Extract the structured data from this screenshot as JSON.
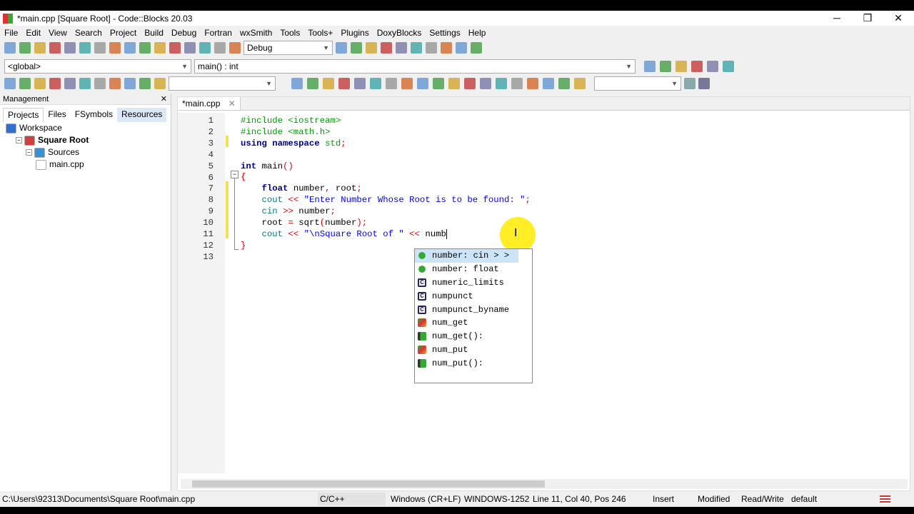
{
  "window": {
    "title": "*main.cpp [Square Root] - Code::Blocks 20.03",
    "minimize": "─",
    "restore": "❐",
    "close": "✕"
  },
  "menu": [
    "File",
    "Edit",
    "View",
    "Search",
    "Project",
    "Build",
    "Debug",
    "Fortran",
    "wxSmith",
    "Tools",
    "Tools+",
    "Plugins",
    "DoxyBlocks",
    "Settings",
    "Help"
  ],
  "toolbar1": {
    "icons": [
      "new-file",
      "open",
      "save",
      "save-all",
      "undo",
      "redo",
      "cut",
      "copy",
      "paste",
      "find",
      "replace",
      "build",
      "run",
      "build-run",
      "rebuild",
      "abort"
    ],
    "build_target": "Debug",
    "debug_icons": [
      "debug-run",
      "step-into",
      "step-over",
      "step-out",
      "next-instr",
      "step-instr",
      "break",
      "stop",
      "debug-windows",
      "info"
    ]
  },
  "toolbar2": {
    "scope": "<global>",
    "function": "main() : int",
    "icons": [
      "jump-back",
      "jump-forward",
      "toggle-bookmark",
      "prev-bookmark",
      "next-bookmark",
      "clear-bookmarks"
    ]
  },
  "toolbar3": {
    "search_value": "",
    "search2_value": "",
    "icons": [
      "doxy-extract",
      "doxy-run",
      "comment-block",
      "comment-line",
      "html",
      "chm",
      "settings",
      "prev-mark",
      "mark",
      "next-mark",
      "clear"
    ],
    "right_icons": [
      "prev",
      "next",
      "highlight",
      "insert",
      "match-case",
      "regex",
      "select",
      "rect",
      "fit",
      "box1",
      "box2",
      "box3",
      "box4",
      "box5",
      "box6",
      "zoom-in",
      "zoom-out",
      "s-icon",
      "c-icon"
    ]
  },
  "management": {
    "title": "Management",
    "tabs": [
      "Projects",
      "Files",
      "FSymbols",
      "Resources"
    ],
    "tree": [
      {
        "label": "Workspace",
        "level": 0
      },
      {
        "label": "Square Root",
        "level": 1,
        "bold": true
      },
      {
        "label": "Sources",
        "level": 2
      },
      {
        "label": "main.cpp",
        "level": 3
      }
    ]
  },
  "editor": {
    "tab": "*main.cpp",
    "tab_close": "✕",
    "lines": [
      [
        [
          "#include <iostream>",
          "pp"
        ]
      ],
      [
        [
          "#include <math.h>",
          "pp"
        ]
      ],
      [
        [
          "using namespace ",
          "kw"
        ],
        [
          "std",
          "pp"
        ],
        [
          ";",
          "op"
        ]
      ],
      [],
      [
        [
          "int ",
          "kw"
        ],
        [
          "main",
          "id"
        ],
        [
          "()",
          "op"
        ]
      ],
      [
        [
          "{",
          "op"
        ]
      ],
      [
        [
          "    "
        ],
        [
          "float ",
          "kw"
        ],
        [
          "number",
          "id"
        ],
        [
          ", ",
          "op"
        ],
        [
          "root",
          "id"
        ],
        [
          ";",
          "op"
        ]
      ],
      [
        [
          "    "
        ],
        [
          "cout ",
          "sd"
        ],
        [
          "<< ",
          "op"
        ],
        [
          "\"Enter Number Whose Root is to be found: \"",
          "st"
        ],
        [
          ";",
          "op"
        ]
      ],
      [
        [
          "    "
        ],
        [
          "cin ",
          "sd"
        ],
        [
          ">> ",
          "op"
        ],
        [
          "number",
          "id"
        ],
        [
          ";",
          "op"
        ]
      ],
      [
        [
          "    "
        ],
        [
          "root ",
          "id"
        ],
        [
          "= ",
          "op"
        ],
        [
          "sqrt",
          "id"
        ],
        [
          "(",
          "op"
        ],
        [
          "number",
          "id"
        ],
        [
          ");",
          "op"
        ]
      ],
      [
        [
          "    "
        ],
        [
          "cout ",
          "sd"
        ],
        [
          "<< ",
          "op"
        ],
        [
          "\"\\nSquare Root of \" ",
          "st"
        ],
        [
          "<< ",
          "op"
        ],
        [
          "numb",
          "id"
        ]
      ],
      [
        [
          "}",
          "op"
        ]
      ],
      []
    ]
  },
  "autocomplete": [
    {
      "label": "number: cin > >",
      "icon": "variable",
      "selected": true
    },
    {
      "label": "number: float",
      "icon": "variable"
    },
    {
      "label": "numeric_limits",
      "icon": "class"
    },
    {
      "label": "numpunct",
      "icon": "class"
    },
    {
      "label": "numpunct_byname",
      "icon": "class"
    },
    {
      "label": "num_get",
      "icon": "namespace"
    },
    {
      "label": "num_get():",
      "icon": "function"
    },
    {
      "label": "num_put",
      "icon": "namespace"
    },
    {
      "label": "num_put():",
      "icon": "function"
    }
  ],
  "status": {
    "path": "C:\\Users\\92313\\Documents\\Square Root\\main.cpp",
    "language": "C/C++",
    "eol": "Windows (CR+LF)",
    "encoding": "WINDOWS-1252",
    "position": "Line 11, Col 40, Pos 246",
    "mode": "Insert",
    "modified": "Modified",
    "access": "Read/Write",
    "profile": "default"
  }
}
